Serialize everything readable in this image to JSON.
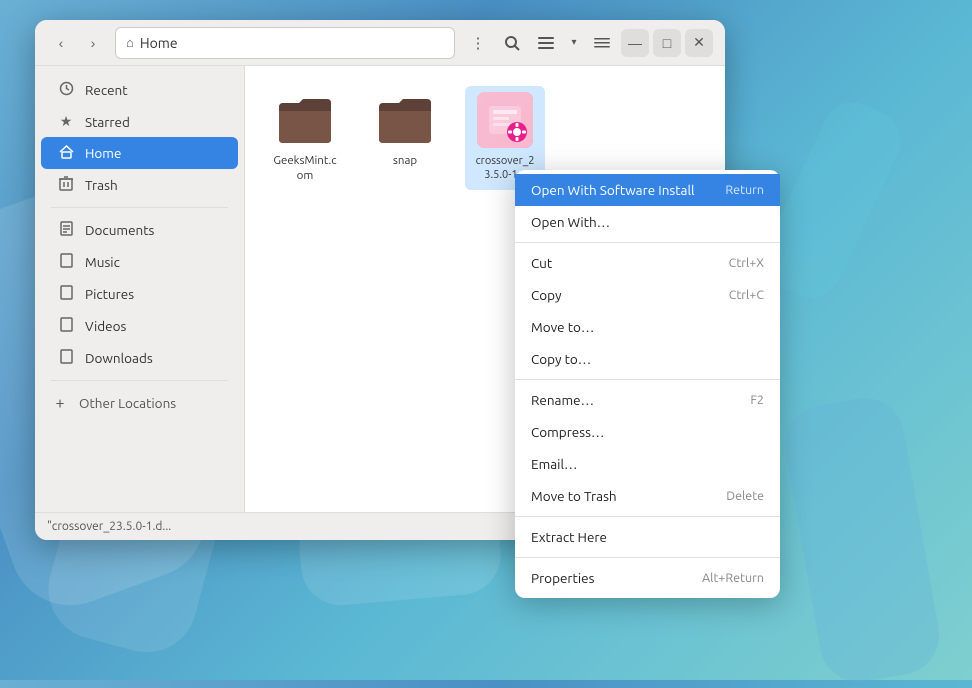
{
  "window": {
    "title": "Home",
    "status_text": "\"crossover_23.5.0-1.d..."
  },
  "titlebar": {
    "back_label": "‹",
    "forward_label": "›",
    "location": "Home",
    "home_icon": "⌂",
    "menu_icon": "⋮",
    "search_icon": "🔍",
    "view_icon": "☰",
    "view_dropdown_icon": "▾",
    "list_icon": "≡",
    "minimize_icon": "—",
    "maximize_icon": "□",
    "close_icon": "✕"
  },
  "sidebar": {
    "items": [
      {
        "id": "recent",
        "label": "Recent",
        "icon": "🕐"
      },
      {
        "id": "starred",
        "label": "Starred",
        "icon": "★"
      },
      {
        "id": "home",
        "label": "Home",
        "icon": "⌂",
        "active": true
      },
      {
        "id": "trash",
        "label": "Trash",
        "icon": "🗑"
      }
    ],
    "places": [
      {
        "id": "documents",
        "label": "Documents",
        "icon": "📄"
      },
      {
        "id": "music",
        "label": "Music",
        "icon": "📄"
      },
      {
        "id": "pictures",
        "label": "Pictures",
        "icon": "📄"
      },
      {
        "id": "videos",
        "label": "Videos",
        "icon": "📄"
      },
      {
        "id": "downloads",
        "label": "Downloads",
        "icon": "📄"
      }
    ],
    "other_locations": {
      "label": "Other Locations",
      "icon": "+"
    }
  },
  "files": [
    {
      "id": "geeksmint",
      "name": "GeeksMint.com",
      "type": "folder"
    },
    {
      "id": "snap",
      "name": "snap",
      "type": "folder"
    },
    {
      "id": "crossover",
      "name": "crossover_2\n3.5.0-1...",
      "type": "deb",
      "selected": true
    }
  ],
  "context_menu": {
    "items": [
      {
        "id": "open-with-software",
        "label": "Open With Software Install",
        "shortcut": "Return",
        "highlighted": true
      },
      {
        "id": "open-with",
        "label": "Open With…",
        "shortcut": ""
      },
      {
        "id": "cut",
        "label": "Cut",
        "shortcut": "Ctrl+X"
      },
      {
        "id": "copy",
        "label": "Copy",
        "shortcut": "Ctrl+C"
      },
      {
        "id": "move-to",
        "label": "Move to…",
        "shortcut": ""
      },
      {
        "id": "copy-to",
        "label": "Copy to…",
        "shortcut": ""
      },
      {
        "id": "rename",
        "label": "Rename…",
        "shortcut": "F2"
      },
      {
        "id": "compress",
        "label": "Compress…",
        "shortcut": ""
      },
      {
        "id": "email",
        "label": "Email…",
        "shortcut": ""
      },
      {
        "id": "move-to-trash",
        "label": "Move to Trash",
        "shortcut": "Delete"
      },
      {
        "id": "extract-here",
        "label": "Extract Here",
        "shortcut": ""
      },
      {
        "id": "properties",
        "label": "Properties",
        "shortcut": "Alt+Return"
      }
    ]
  }
}
